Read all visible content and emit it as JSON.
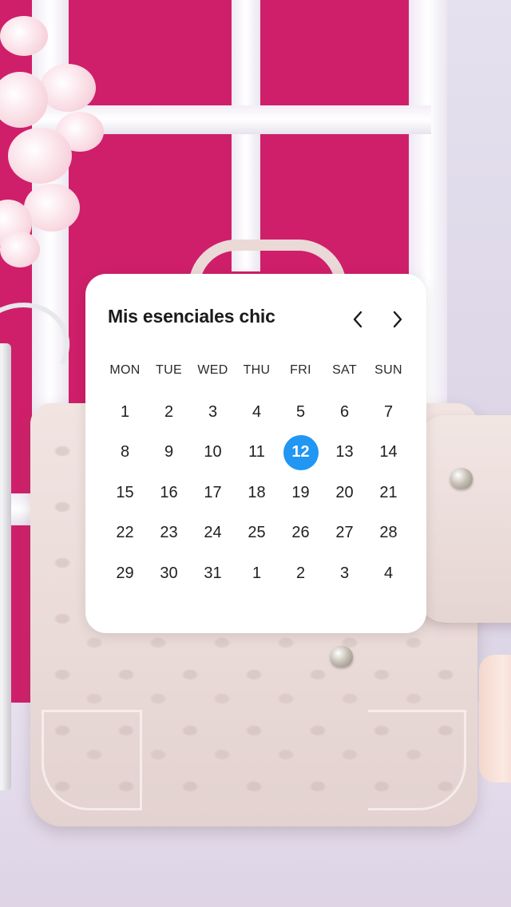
{
  "calendar": {
    "title": "Mis esenciales chic",
    "prev_icon": "chevron-left-icon",
    "next_icon": "chevron-right-icon",
    "weekdays": [
      "MON",
      "TUE",
      "WED",
      "THU",
      "FRI",
      "SAT",
      "SUN"
    ],
    "days": [
      "1",
      "2",
      "3",
      "4",
      "5",
      "6",
      "7",
      "8",
      "9",
      "10",
      "11",
      "12",
      "13",
      "14",
      "15",
      "16",
      "17",
      "18",
      "19",
      "20",
      "21",
      "22",
      "23",
      "24",
      "25",
      "26",
      "27",
      "28",
      "29",
      "30",
      "31",
      "1",
      "2",
      "3",
      "4"
    ],
    "selected_day": "12",
    "accent_color": "#2196f3"
  }
}
